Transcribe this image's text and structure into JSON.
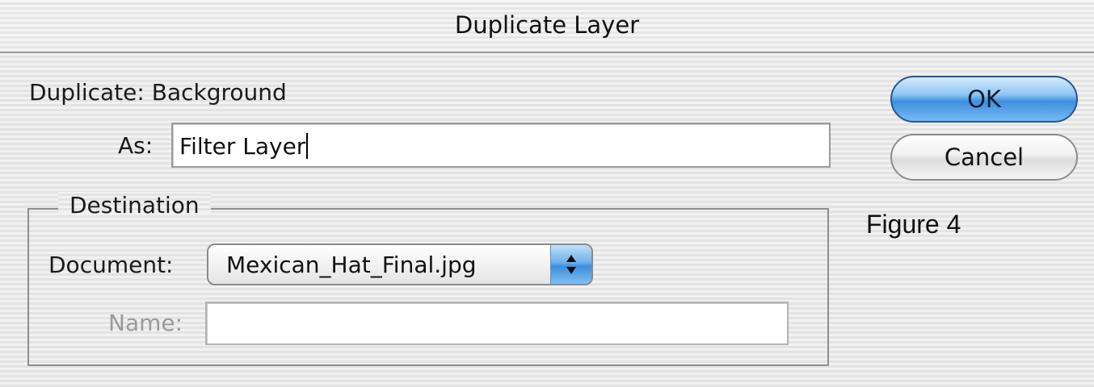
{
  "window": {
    "title": "Duplicate Layer"
  },
  "source": {
    "label": "Duplicate:",
    "value": "Background"
  },
  "as_field": {
    "label": "As:",
    "value": "Filter Layer"
  },
  "destination": {
    "legend": "Destination",
    "document_label": "Document:",
    "document_value": "Mexican_Hat_Final.jpg",
    "name_label": "Name:",
    "name_value": ""
  },
  "buttons": {
    "ok": "OK",
    "cancel": "Cancel"
  },
  "annotation": "Figure 4",
  "colors": {
    "ok_button": "#4a96e4",
    "disabled_text": "#9a9a9a",
    "accent_arrows": "#3e8ede"
  }
}
